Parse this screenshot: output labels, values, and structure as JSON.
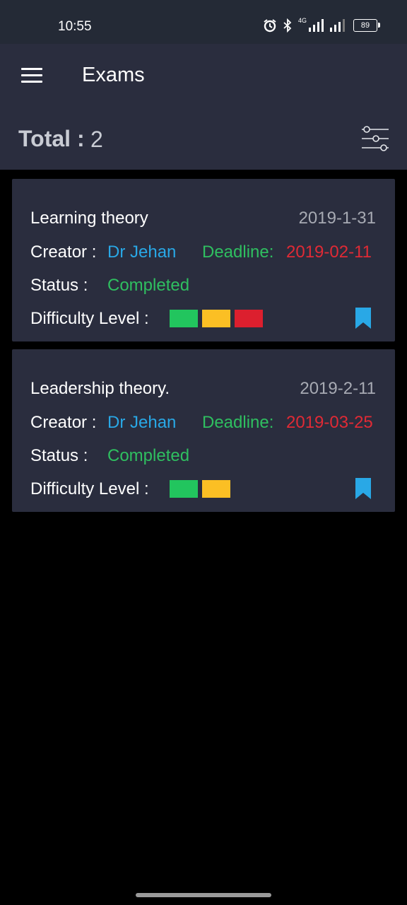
{
  "status_bar": {
    "time": "10:55",
    "network": "4G",
    "battery": "89"
  },
  "app_bar": {
    "title": "Exams",
    "menu_icon": "hamburger-menu-icon"
  },
  "summary": {
    "total_label": "Total :",
    "total_value": "2",
    "filter_icon": "filter-sliders-icon"
  },
  "exams": [
    {
      "title": "Learning theory",
      "date": "2019-1-31",
      "creator_label": "Creator :",
      "creator": "Dr Jehan",
      "deadline_label": "Deadline:",
      "deadline": "2019-02-11",
      "status_label": "Status :",
      "status": "Completed",
      "difficulty_label": "Difficulty Level :",
      "difficulty_level": 3
    },
    {
      "title": "Leadership theory.",
      "date": "2019-2-11",
      "creator_label": "Creator :",
      "creator": "Dr Jehan",
      "deadline_label": "Deadline:",
      "deadline": "2019-03-25",
      "status_label": "Status :",
      "status": "Completed",
      "difficulty_label": "Difficulty Level :",
      "difficulty_level": 2
    }
  ],
  "colors": {
    "background": "#000000",
    "surface": "#2a2d3e",
    "status_bar": "#242a36",
    "accent_blue": "#29a8e6",
    "success_green": "#2fbf60",
    "deadline_red": "#e02a35",
    "difficulty": [
      "#22c55e",
      "#fbbf24",
      "#dc1f2e"
    ]
  }
}
